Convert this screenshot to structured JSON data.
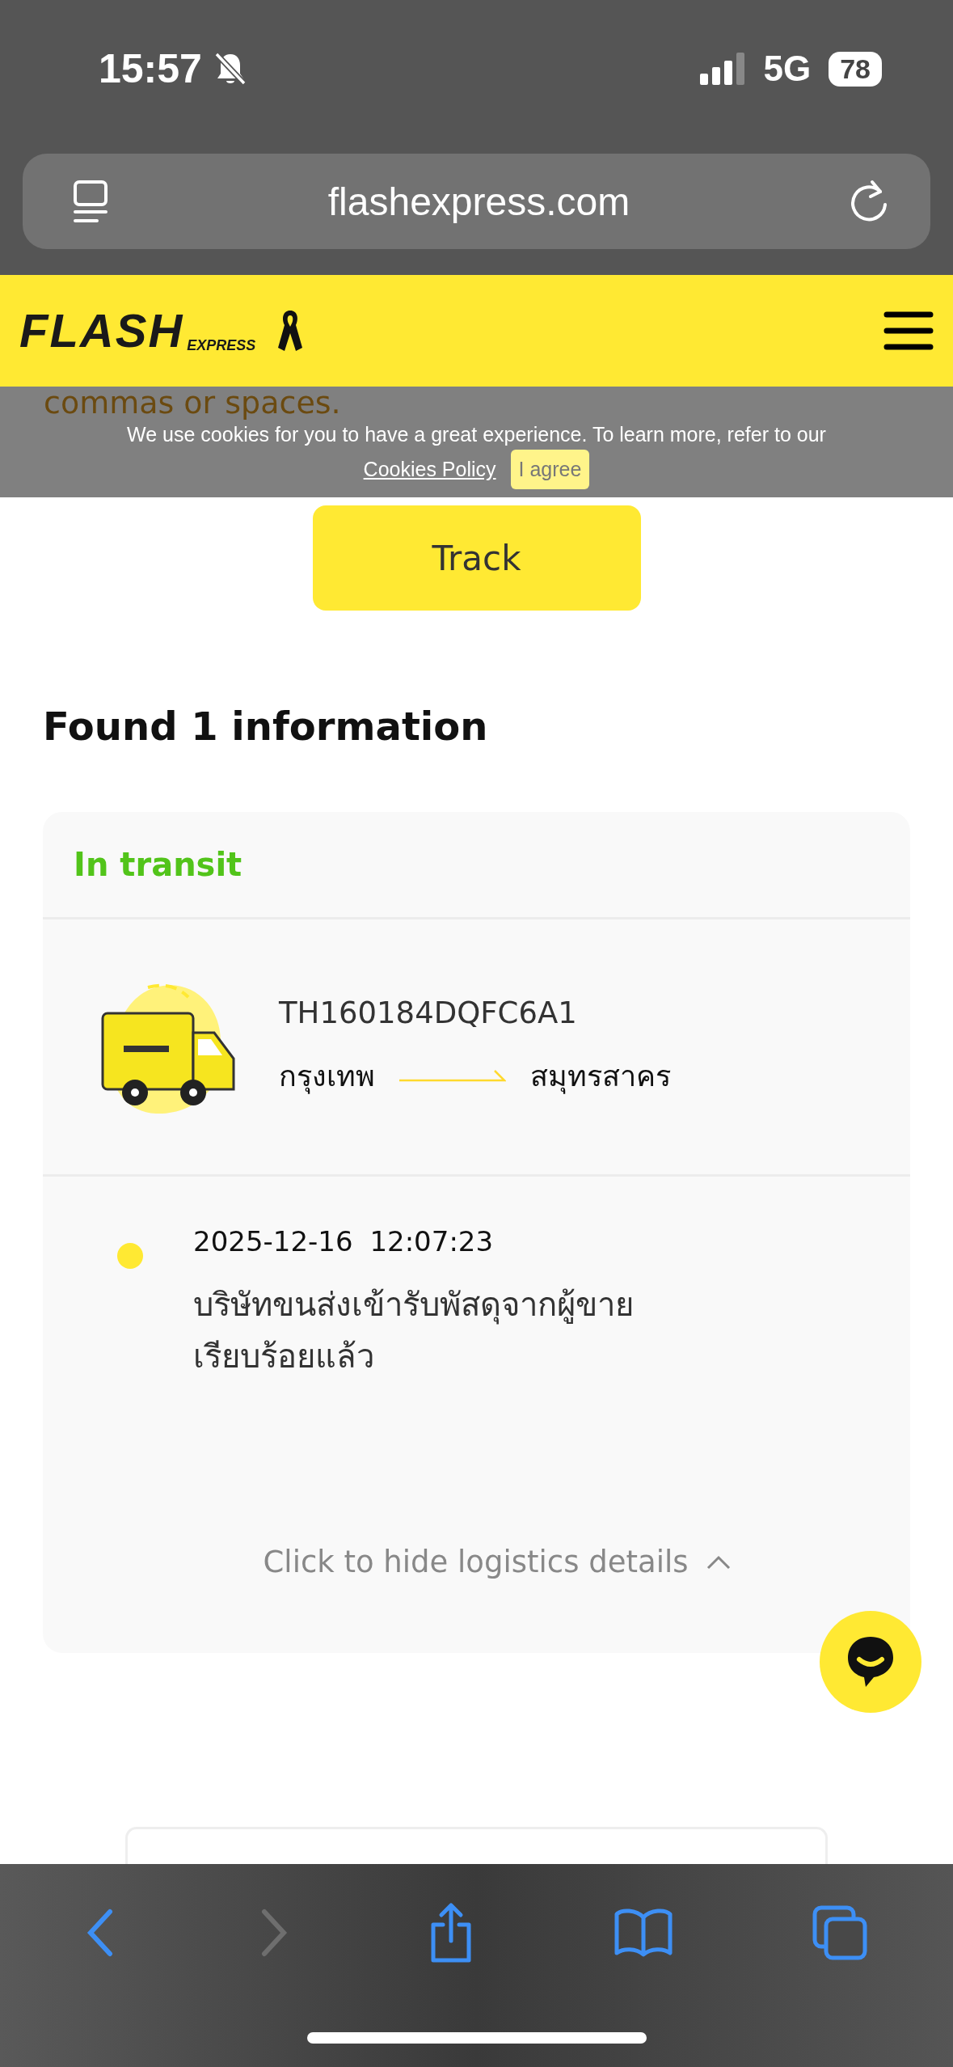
{
  "status_bar": {
    "time": "15:57",
    "network": "5G",
    "battery": "78"
  },
  "address_bar": {
    "url": "flashexpress.com"
  },
  "header": {
    "logo": "FLASH",
    "logo_sub": "EXPRESS"
  },
  "cookie_banner": {
    "behind_text": "commas or spaces.",
    "message": "We use cookies for you to have a great experience. To learn more, refer to our",
    "link": "Cookies Policy",
    "button": "I agree"
  },
  "track_button": "Track",
  "results_title": "Found 1 information",
  "shipment": {
    "status": "In transit",
    "tracking_number": "TH160184DQFC6A1",
    "origin": "กรุงเทพ",
    "destination": "สมุทรสาคร",
    "events": [
      {
        "time": "2025-12-16 12:07:23",
        "description": "บริษัทขนส่งเข้ารับพัสดุจากผู้ขายเรียบร้อยแล้ว"
      }
    ],
    "toggle": {
      "label": "Click to hide logistics details",
      "expanded": true
    }
  },
  "toolbar": [
    {
      "kind": "back",
      "disabled": false
    },
    {
      "kind": "forward",
      "disabled": true
    },
    {
      "kind": "share",
      "disabled": false
    },
    {
      "kind": "bookmarks",
      "disabled": false
    },
    {
      "kind": "tabs",
      "disabled": false
    }
  ]
}
